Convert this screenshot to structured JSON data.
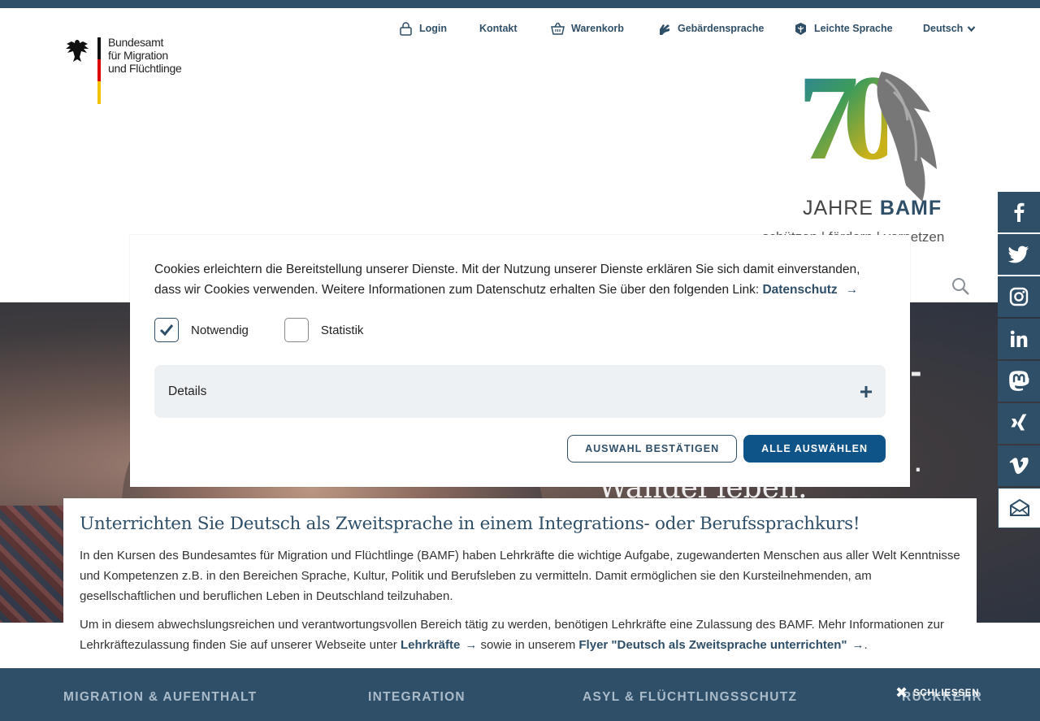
{
  "logo": {
    "lines": [
      "Bundesamt",
      "für Migration",
      "und Flüchtlinge"
    ],
    "icon": "federal-eagle-icon"
  },
  "service_nav": [
    {
      "label": "Login",
      "icon": "lock-icon"
    },
    {
      "label": "Kontakt",
      "icon": ""
    },
    {
      "label": "Warenkorb",
      "icon": "basket-icon"
    },
    {
      "label": "Gebärdensprache",
      "icon": "sign-language-icon"
    },
    {
      "label": "Leichte Sprache",
      "icon": "easy-language-icon"
    },
    {
      "label": "Deutsch",
      "icon": "chevron-down-icon"
    }
  ],
  "anniversary": {
    "number": "70",
    "jahre": "JAHRE",
    "bamf": "BAMF",
    "tagline": "schützen | fördern | vernetzen"
  },
  "hero": {
    "title_fragment": "ck -",
    "line2_fragment": ".",
    "line3": "Wandel leben."
  },
  "cookie_modal": {
    "message": "Cookies erleichtern die Bereitstellung unserer Dienste. Mit der Nutzung unserer Dienste erklären Sie sich damit einverstanden, dass wir Cookies verwenden. Weitere Informationen zum Datenschutz erhalten Sie über den folgenden Link:",
    "privacy_link": "Datenschutz",
    "checkboxes": [
      {
        "label": "Notwendig",
        "checked": true
      },
      {
        "label": "Statistik",
        "checked": false
      }
    ],
    "details_label": "Details",
    "confirm_button": "AUSWAHL BESTÄTIGEN",
    "select_all_button": "ALLE AUSWÄHLEN"
  },
  "info_box": {
    "heading": "Unterrichten Sie Deutsch als Zweitsprache in einem Integrations- oder Berufssprachkurs!",
    "paragraph1": "In den Kursen des Bundesamtes für Migration und Flüchtlinge (BAMF) haben Lehrkräfte die wichtige Aufgabe, zugewanderten Menschen aus aller Welt Kenntnisse und Kompetenzen z.B. in den Bereichen Sprache, Kultur, Politik und Berufsleben zu vermitteln. Damit ermöglichen sie den Kursteilnehmenden, am gesellschaftlichen und beruflichen Leben in Deutschland teilzuhaben.",
    "paragraph2_before": "Um in diesem abwechslungsreichen und verantwortungsvollen Bereich tätig zu werden, benötigen Lehrkräfte eine Zulassung des BAMF. Mehr Informationen zur Lehrkräftezulassung finden Sie auf unserer Webseite unter",
    "link1": "Lehrkräfte",
    "paragraph2_middle": "sowie in unserem",
    "link2": "Flyer \"Deutsch als Zweitsprache unterrichten\"",
    "paragraph2_end": "."
  },
  "footer_nav": [
    "MIGRATION & AUFENTHALT",
    "INTEGRATION",
    "ASYL & FLÜCHTLINGSSCHUTZ",
    "RÜCKKEHR"
  ],
  "close_label": "SCHLIESSEN",
  "social": [
    {
      "name": "facebook-icon",
      "glyph": "f"
    },
    {
      "name": "twitter-icon",
      "glyph": ""
    },
    {
      "name": "instagram-icon",
      "glyph": ""
    },
    {
      "name": "linkedin-icon",
      "glyph": "in"
    },
    {
      "name": "mastodon-icon",
      "glyph": "m"
    },
    {
      "name": "xing-icon",
      "glyph": "x"
    },
    {
      "name": "vimeo-icon",
      "glyph": "v"
    },
    {
      "name": "newsletter-icon",
      "glyph": ""
    }
  ],
  "colors": {
    "brand": "#2f4e68",
    "button_primary": "#0f5488",
    "details_bg": "#eef1f4"
  }
}
